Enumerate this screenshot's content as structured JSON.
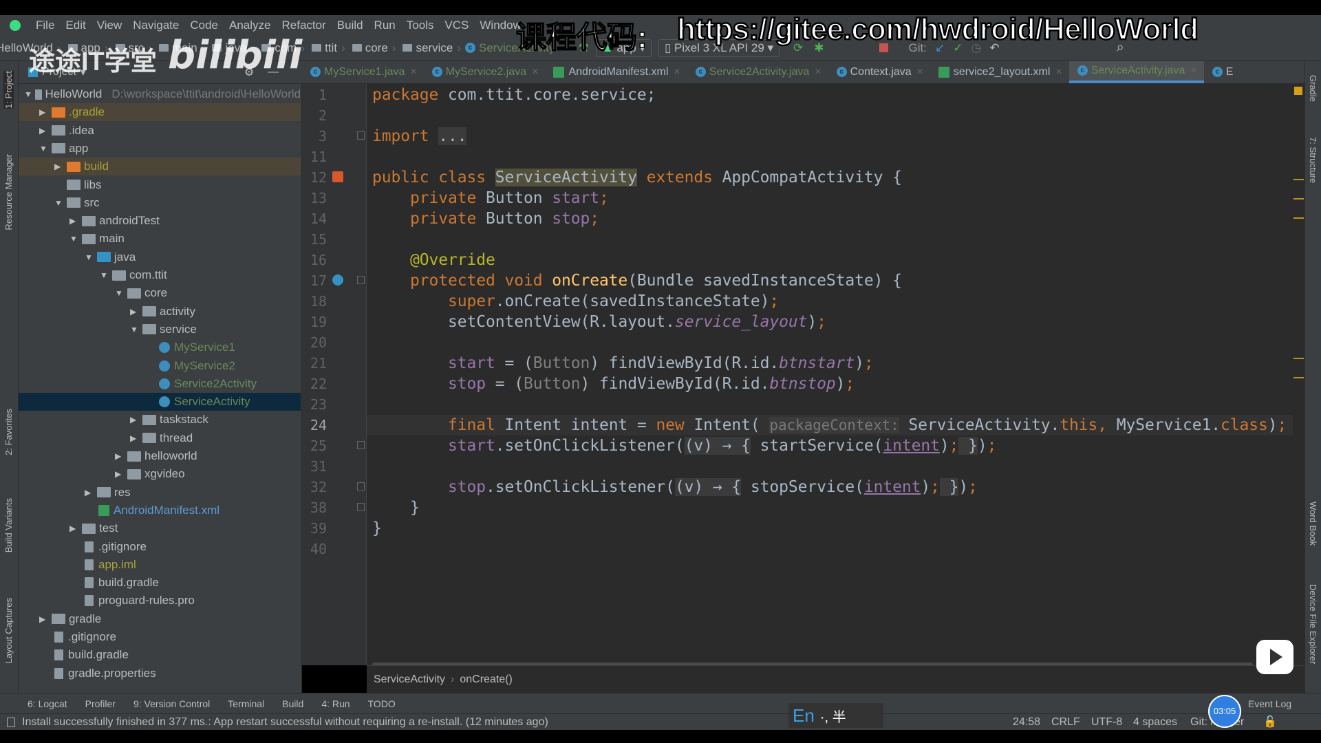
{
  "menu": [
    "File",
    "Edit",
    "View",
    "Navigate",
    "Code",
    "Analyze",
    "Refactor",
    "Build",
    "Run",
    "Tools",
    "VCS",
    "Window"
  ],
  "nav": {
    "crumbs": [
      "HelloWorld",
      "app",
      "src",
      "main",
      "java",
      "com",
      "ttit",
      "core",
      "service"
    ],
    "current": "ServiceActivity",
    "run_config": "app",
    "device": "Pixel 3 XL API 29",
    "git_label": "Git:"
  },
  "overlay": {
    "label": "课程代码:",
    "url": "https://gitee.com/hwdroid/HelloWorld",
    "watermark": "途途IT学堂",
    "watermark_logo": "bilibili"
  },
  "left_strip": [
    "1: Project",
    "Resource Manager",
    "2: Favorites",
    "Build Variants",
    "Layout Captures"
  ],
  "right_strip": [
    "Gradle",
    "7: Structure",
    "Word Book",
    "Device File Explorer"
  ],
  "project": {
    "header": "Project",
    "root_path": "D:\\workspace\\ttit\\android\\HelloWorld",
    "tree": [
      {
        "label": "HelloWorld",
        "level": 0,
        "arrow": "open",
        "icon": "module"
      },
      {
        "label": ".gradle",
        "level": 1,
        "arrow": "closed",
        "icon": "folder-orange",
        "style": "hl"
      },
      {
        "label": ".idea",
        "level": 1,
        "arrow": "closed",
        "icon": "folder"
      },
      {
        "label": "app",
        "level": 1,
        "arrow": "open",
        "icon": "folder"
      },
      {
        "label": "build",
        "level": 2,
        "arrow": "closed",
        "icon": "folder-orange",
        "style": "hl"
      },
      {
        "label": "libs",
        "level": 2,
        "arrow": "none",
        "icon": "folder"
      },
      {
        "label": "src",
        "level": 2,
        "arrow": "open",
        "icon": "folder"
      },
      {
        "label": "androidTest",
        "level": 3,
        "arrow": "closed",
        "icon": "folder"
      },
      {
        "label": "main",
        "level": 3,
        "arrow": "open",
        "icon": "folder"
      },
      {
        "label": "java",
        "level": 4,
        "arrow": "open",
        "icon": "folder-blue"
      },
      {
        "label": "com.ttit",
        "level": 5,
        "arrow": "open",
        "icon": "package"
      },
      {
        "label": "core",
        "level": 6,
        "arrow": "open",
        "icon": "package"
      },
      {
        "label": "activity",
        "level": 7,
        "arrow": "closed",
        "icon": "package"
      },
      {
        "label": "service",
        "level": 7,
        "arrow": "open",
        "icon": "package"
      },
      {
        "label": "MyService1",
        "level": 8,
        "arrow": "none",
        "icon": "class"
      },
      {
        "label": "MyService2",
        "level": 8,
        "arrow": "none",
        "icon": "class"
      },
      {
        "label": "Service2Activity",
        "level": 8,
        "arrow": "none",
        "icon": "class"
      },
      {
        "label": "ServiceActivity",
        "level": 8,
        "arrow": "none",
        "icon": "class",
        "selected": true
      },
      {
        "label": "taskstack",
        "level": 7,
        "arrow": "closed",
        "icon": "package"
      },
      {
        "label": "thread",
        "level": 7,
        "arrow": "closed",
        "icon": "package"
      },
      {
        "label": "helloworld",
        "level": 6,
        "arrow": "closed",
        "icon": "package"
      },
      {
        "label": "xgvideo",
        "level": 6,
        "arrow": "closed",
        "icon": "package"
      },
      {
        "label": "res",
        "level": 4,
        "arrow": "closed",
        "icon": "folder"
      },
      {
        "label": "AndroidManifest.xml",
        "level": 4,
        "arrow": "none",
        "icon": "manifest"
      },
      {
        "label": "test",
        "level": 3,
        "arrow": "closed",
        "icon": "folder"
      },
      {
        "label": ".gitignore",
        "level": 3,
        "arrow": "none",
        "icon": "file"
      },
      {
        "label": "app.iml",
        "level": 3,
        "arrow": "none",
        "icon": "file",
        "style": "hltext"
      },
      {
        "label": "build.gradle",
        "level": 3,
        "arrow": "none",
        "icon": "gradle"
      },
      {
        "label": "proguard-rules.pro",
        "level": 3,
        "arrow": "none",
        "icon": "file"
      },
      {
        "label": "gradle",
        "level": 1,
        "arrow": "closed",
        "icon": "folder"
      },
      {
        "label": ".gitignore",
        "level": 1,
        "arrow": "none",
        "icon": "file"
      },
      {
        "label": "build.gradle",
        "level": 1,
        "arrow": "none",
        "icon": "gradle"
      },
      {
        "label": "gradle.properties",
        "level": 1,
        "arrow": "none",
        "icon": "file"
      }
    ]
  },
  "tabs": [
    {
      "label": "MyService1.java",
      "kind": "class"
    },
    {
      "label": "MyService2.java",
      "kind": "class"
    },
    {
      "label": "AndroidManifest.xml",
      "kind": "xml"
    },
    {
      "label": "Service2Activity.java",
      "kind": "class"
    },
    {
      "label": "Context.java",
      "kind": "plain"
    },
    {
      "label": "service2_layout.xml",
      "kind": "xml"
    },
    {
      "label": "ServiceActivity.java",
      "kind": "class",
      "active": true
    },
    {
      "label": "E",
      "kind": "plain"
    }
  ],
  "code": {
    "current_line": "24",
    "lines": [
      {
        "n": "1",
        "t": [
          [
            "package",
            "kw"
          ],
          [
            " com.ttit.core.service;",
            ""
          ]
        ]
      },
      {
        "n": "2",
        "t": []
      },
      {
        "n": "3",
        "t": [
          [
            "import",
            "kw"
          ],
          [
            " ",
            ""
          ],
          [
            "...",
            "fold"
          ]
        ]
      },
      {
        "n": "11",
        "t": []
      },
      {
        "n": "12",
        "t": [
          [
            "public class ",
            "kw"
          ],
          [
            "ServiceActivity",
            "sel"
          ],
          [
            " extends ",
            "kw"
          ],
          [
            "AppCompatActivity {",
            ""
          ]
        ]
      },
      {
        "n": "13",
        "t": [
          [
            "    private ",
            "kw"
          ],
          [
            "Button ",
            ""
          ],
          [
            "start",
            "fld"
          ],
          [
            ";",
            "kw"
          ]
        ]
      },
      {
        "n": "14",
        "t": [
          [
            "    private ",
            "kw"
          ],
          [
            "Button ",
            ""
          ],
          [
            "stop",
            "fld"
          ],
          [
            ";",
            "kw"
          ]
        ]
      },
      {
        "n": "15",
        "t": []
      },
      {
        "n": "16",
        "t": [
          [
            "    @Override",
            "ann"
          ]
        ]
      },
      {
        "n": "17",
        "t": [
          [
            "    protected void ",
            "kw"
          ],
          [
            "onCreate",
            "mdecl"
          ],
          [
            "(Bundle savedInstanceState) {",
            ""
          ]
        ]
      },
      {
        "n": "18",
        "t": [
          [
            "        super",
            "kw"
          ],
          [
            ".onCreate(savedInstanceState)",
            ""
          ],
          [
            ";",
            "kw"
          ]
        ]
      },
      {
        "n": "19",
        "t": [
          [
            "        setContentView(R.layout.",
            ""
          ],
          [
            "service_layout",
            "ital"
          ],
          [
            ")",
            ""
          ],
          [
            ";",
            "kw"
          ]
        ]
      },
      {
        "n": "20",
        "t": []
      },
      {
        "n": "21",
        "t": [
          [
            "        ",
            ""
          ],
          [
            "start",
            "fld"
          ],
          [
            " = (",
            ""
          ],
          [
            "Button",
            "grey"
          ],
          [
            ") findViewById(R.id.",
            ""
          ],
          [
            "btnstart",
            "ital"
          ],
          [
            ")",
            ""
          ],
          [
            ";",
            "kw"
          ]
        ]
      },
      {
        "n": "22",
        "t": [
          [
            "        ",
            ""
          ],
          [
            "stop",
            "fld"
          ],
          [
            " = (",
            ""
          ],
          [
            "Button",
            "grey"
          ],
          [
            ") findViewById(R.id.",
            ""
          ],
          [
            "btnstop",
            "ital"
          ],
          [
            ")",
            ""
          ],
          [
            ";",
            "kw"
          ]
        ]
      },
      {
        "n": "23",
        "t": []
      },
      {
        "n": "24",
        "t": [
          [
            "        final ",
            "kw"
          ],
          [
            "Intent intent = ",
            ""
          ],
          [
            "new ",
            "kw"
          ],
          [
            "Intent( ",
            ""
          ],
          [
            "packageContext:",
            "hint"
          ],
          [
            " ServiceActivity.",
            ""
          ],
          [
            "this",
            "kw"
          ],
          [
            ", ",
            "kw"
          ],
          [
            "MyService1.",
            ""
          ],
          [
            "class",
            "kw"
          ],
          [
            ")",
            ""
          ],
          [
            ";",
            "kw"
          ]
        ]
      },
      {
        "n": "25",
        "t": [
          [
            "        ",
            ""
          ],
          [
            "start",
            "fld"
          ],
          [
            ".setOnClickListener(",
            ""
          ],
          [
            "(v) → {",
            "fold"
          ],
          [
            " startService(",
            ""
          ],
          [
            "intent",
            "ul"
          ],
          [
            ")",
            ""
          ],
          [
            ";",
            "kw"
          ],
          [
            " }",
            "fold"
          ],
          [
            ")",
            ""
          ],
          [
            ";",
            "kw"
          ]
        ]
      },
      {
        "n": "31",
        "t": []
      },
      {
        "n": "32",
        "t": [
          [
            "        ",
            ""
          ],
          [
            "stop",
            "fld"
          ],
          [
            ".setOnClickListener(",
            ""
          ],
          [
            "(v) → {",
            "fold"
          ],
          [
            " stopService(",
            ""
          ],
          [
            "intent",
            "ul"
          ],
          [
            ")",
            ""
          ],
          [
            ";",
            "kw"
          ],
          [
            " }",
            "fold"
          ],
          [
            ")",
            ""
          ],
          [
            ";",
            "kw"
          ]
        ]
      },
      {
        "n": "38",
        "t": [
          [
            "    }",
            ""
          ]
        ]
      },
      {
        "n": "39",
        "t": [
          [
            "}",
            ""
          ]
        ]
      },
      {
        "n": "40",
        "t": []
      }
    ]
  },
  "editor_breadcrumb": [
    "ServiceActivity",
    "onCreate()"
  ],
  "tool_windows": [
    "6: Logcat",
    "Profiler",
    "9: Version Control",
    "Terminal",
    "Build",
    "4: Run",
    "TODO"
  ],
  "event_log": "Event Log",
  "status": {
    "message": "Install successfully finished in 377 ms.: App restart successful without requiring a re-install. (12 minutes ago)",
    "position": "24:58",
    "line_sep": "CRLF",
    "encoding": "UTF-8",
    "indent": "4 spaces",
    "git": "Git: master",
    "timer": "03:05",
    "ime": "En",
    "ime_extra": "·, 半"
  },
  "colors": {
    "editor_bg": "#2b2b2b",
    "panel_bg": "#3c3f41",
    "keyword": "#cc7832",
    "field": "#9876aa",
    "accent": "#4a88c7"
  }
}
